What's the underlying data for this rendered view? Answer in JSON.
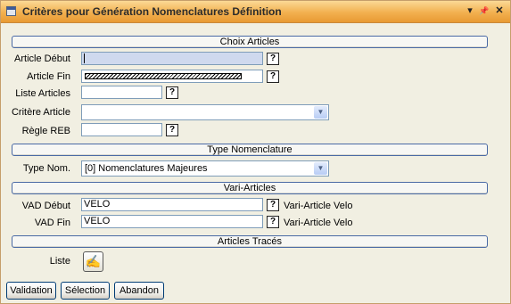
{
  "window": {
    "title": "Critères pour Génération Nomenclatures Définition",
    "menu_glyph": "▾",
    "pin_glyph": "📌",
    "close_glyph": "✕"
  },
  "sections": {
    "choix": "Choix Articles",
    "type": "Type Nomenclature",
    "vari": "Vari-Articles",
    "traces": "Articles Tracés"
  },
  "fields": {
    "article_debut": {
      "label": "Article Début",
      "value": ""
    },
    "article_fin": {
      "label": "Article Fin",
      "value": ""
    },
    "liste_articles": {
      "label": "Liste Articles",
      "value": ""
    },
    "critere_article": {
      "label": "Critère Article",
      "value": ""
    },
    "regle_reb": {
      "label": "Règle REB",
      "value": ""
    },
    "type_nom": {
      "label": "Type Nom.",
      "value": "[0] Nomenclatures Majeures"
    },
    "vad_debut": {
      "label": "VAD Début",
      "value": "VELO",
      "hint": "Vari-Article Velo"
    },
    "vad_fin": {
      "label": "VAD Fin",
      "value": "VELO",
      "hint": "Vari-Article Velo"
    },
    "liste": {
      "label": "Liste"
    }
  },
  "help_glyph": "?",
  "dropdown_glyph": "▼",
  "pick_glyph": "✍",
  "buttons": {
    "validation": "Validation",
    "selection": "Sélection",
    "abandon": "Abandon"
  }
}
